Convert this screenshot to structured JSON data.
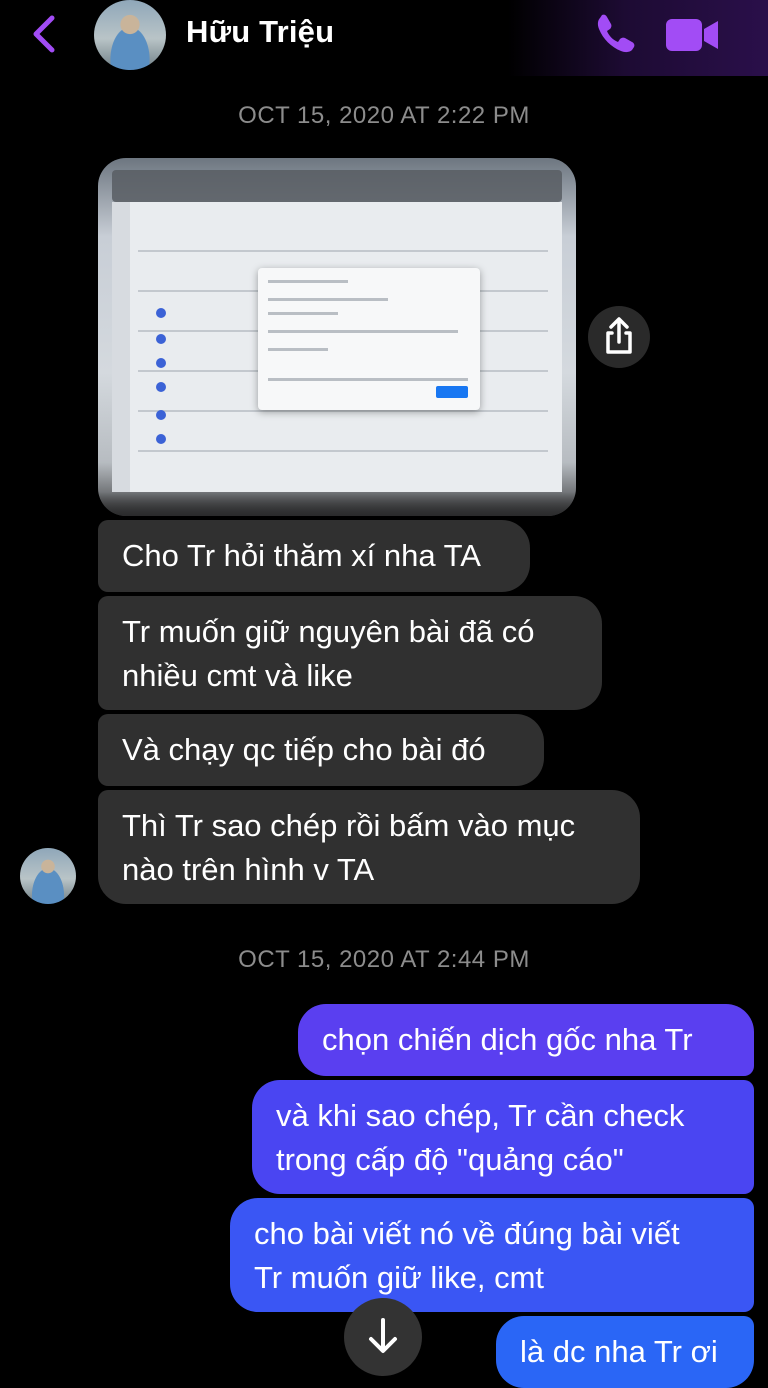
{
  "header": {
    "contact_name": "Hữu Triệu",
    "back_icon": "chevron-left-icon",
    "call_icon": "phone-icon",
    "video_icon": "video-camera-icon",
    "accent_color": "#a24cf5"
  },
  "timestamps": [
    "OCT 15, 2020 AT 2:22 PM",
    "OCT 15, 2020 AT 2:44 PM"
  ],
  "messages_incoming": [
    {
      "lines": [
        "Cho Tr hỏi thăm xí nha TA"
      ]
    },
    {
      "lines": [
        "Tr muốn giữ nguyên bài đã có",
        "nhiều cmt và like"
      ]
    },
    {
      "lines": [
        "Và chạy qc tiếp cho bài đó"
      ]
    },
    {
      "lines": [
        "Thì Tr sao chép rồi bấm vào mục",
        "nào trên hình v TA"
      ]
    }
  ],
  "messages_outgoing": [
    {
      "lines": [
        "chọn chiến dịch gốc nha Tr"
      ]
    },
    {
      "lines": [
        "và khi sao chép, Tr cần check",
        "trong cấp độ \"quảng cáo\""
      ]
    },
    {
      "lines": [
        "cho bài viết nó về đúng bài viết",
        "Tr muốn giữ like, cmt"
      ]
    },
    {
      "lines": [
        "là dc nha Tr ơi"
      ]
    }
  ],
  "icons": {
    "share": "share-icon",
    "scroll_down": "arrow-down-icon"
  },
  "colors": {
    "incoming_bubble": "#303030",
    "outgoing_bubble": "#3b5cf5",
    "background": "#000000"
  }
}
